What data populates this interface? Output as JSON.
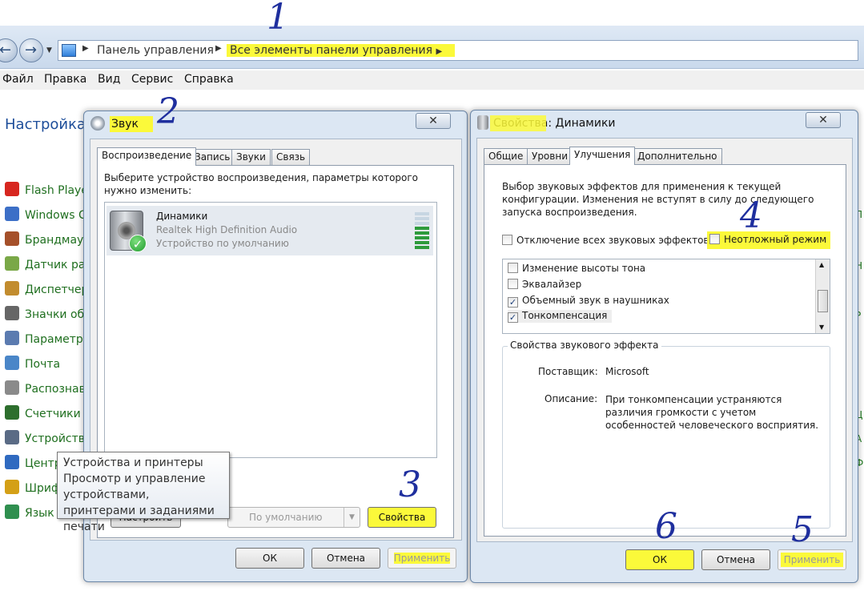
{
  "explorer": {
    "breadcrumb": {
      "root": "Панель управления",
      "current": "Все элементы панели управления"
    },
    "menu": [
      "Файл",
      "Правка",
      "Вид",
      "Сервис",
      "Справка"
    ],
    "heading": "Настройка",
    "items": [
      {
        "label": "Flash Playe",
        "icon": "flash-icon",
        "color": "#d7261f"
      },
      {
        "label": "Windows C",
        "icon": "windows-cardspace-icon",
        "color": "#3c6fc7"
      },
      {
        "label": "Брандмауэ",
        "icon": "firewall-icon",
        "color": "#a5502a"
      },
      {
        "label": "Датчик рас",
        "icon": "location-sensor-icon",
        "color": "#7aa847"
      },
      {
        "label": "Диспетчер",
        "icon": "credential-manager-icon",
        "color": "#c28c2e"
      },
      {
        "label": "Значки обл",
        "icon": "notification-icons-icon",
        "color": "#666666"
      },
      {
        "label": "Параметры",
        "icon": "settings-icon",
        "color": "#5b7bb0"
      },
      {
        "label": "Почта",
        "icon": "mail-icon",
        "color": "#4a86c8"
      },
      {
        "label": "Распознав",
        "icon": "microphone-icon",
        "color": "#8a8a8a"
      },
      {
        "label": "Счетчики и",
        "icon": "performance-icon",
        "color": "#2d6e2d"
      },
      {
        "label": "Устройства",
        "icon": "printer-icon",
        "color": "#5a6b85"
      },
      {
        "label": "Центр",
        "icon": "flag-icon",
        "color": "#2f6ac0"
      },
      {
        "label": "Шриф",
        "icon": "fonts-icon",
        "color": "#d4a017"
      },
      {
        "label": "Язык",
        "icon": "globe-icon",
        "color": "#2f8f4f"
      }
    ]
  },
  "sound_dialog": {
    "title": "Звук",
    "close_glyph": "✕",
    "tabs": [
      "Воспроизведение",
      "Запись",
      "Звуки",
      "Связь"
    ],
    "instruction": "Выберите устройство воспроизведения, параметры которого нужно изменить:",
    "device": {
      "name": "Динамики",
      "driver": "Realtek High Definition Audio",
      "status": "Устройство по умолчанию"
    },
    "configure_button": "Настроить",
    "default_button": "По умолчанию",
    "properties_button": "Свойства",
    "ok": "ОК",
    "cancel": "Отмена",
    "apply": "Применить"
  },
  "props_dialog": {
    "title": "Свойства: Динамики",
    "close_glyph": "✕",
    "tabs": [
      "Общие",
      "Уровни",
      "Улучшения",
      "Дополнительно"
    ],
    "description": "Выбор звуковых эффектов для применения к текущей конфигурации. Изменения не вступят в силу до следующего запуска воспроизведения.",
    "disable_all": "Отключение всех звуковых эффектов",
    "immediate_mode": "Неотложный режим",
    "effects": [
      {
        "label": "Изменение высоты тона",
        "checked": false
      },
      {
        "label": "Эквалайзер",
        "checked": false
      },
      {
        "label": "Объемный звук в наушниках",
        "checked": true
      },
      {
        "label": "Тонкомпенсация",
        "checked": true
      }
    ],
    "group_title": "Свойства звукового эффекта",
    "provider_label": "Поставщик:",
    "provider_value": "Microsoft",
    "description_label": "Описание:",
    "description_value": "При тонкомпенсации устраняются различия громкости с учетом особенностей человеческого восприятия.",
    "ok": "ОК",
    "cancel": "Отмена",
    "apply": "Применить"
  },
  "tooltip": {
    "title": "Устройства и принтеры",
    "text": "Просмотр и управление устройствами, принтерами и заданиями печати"
  },
  "annotations": [
    "1",
    "2",
    "3",
    "4",
    "5",
    "6"
  ],
  "colors": {
    "highlight": "#fbf93a",
    "annotation": "#1f2f9e",
    "link_green": "#1f6f1f"
  }
}
